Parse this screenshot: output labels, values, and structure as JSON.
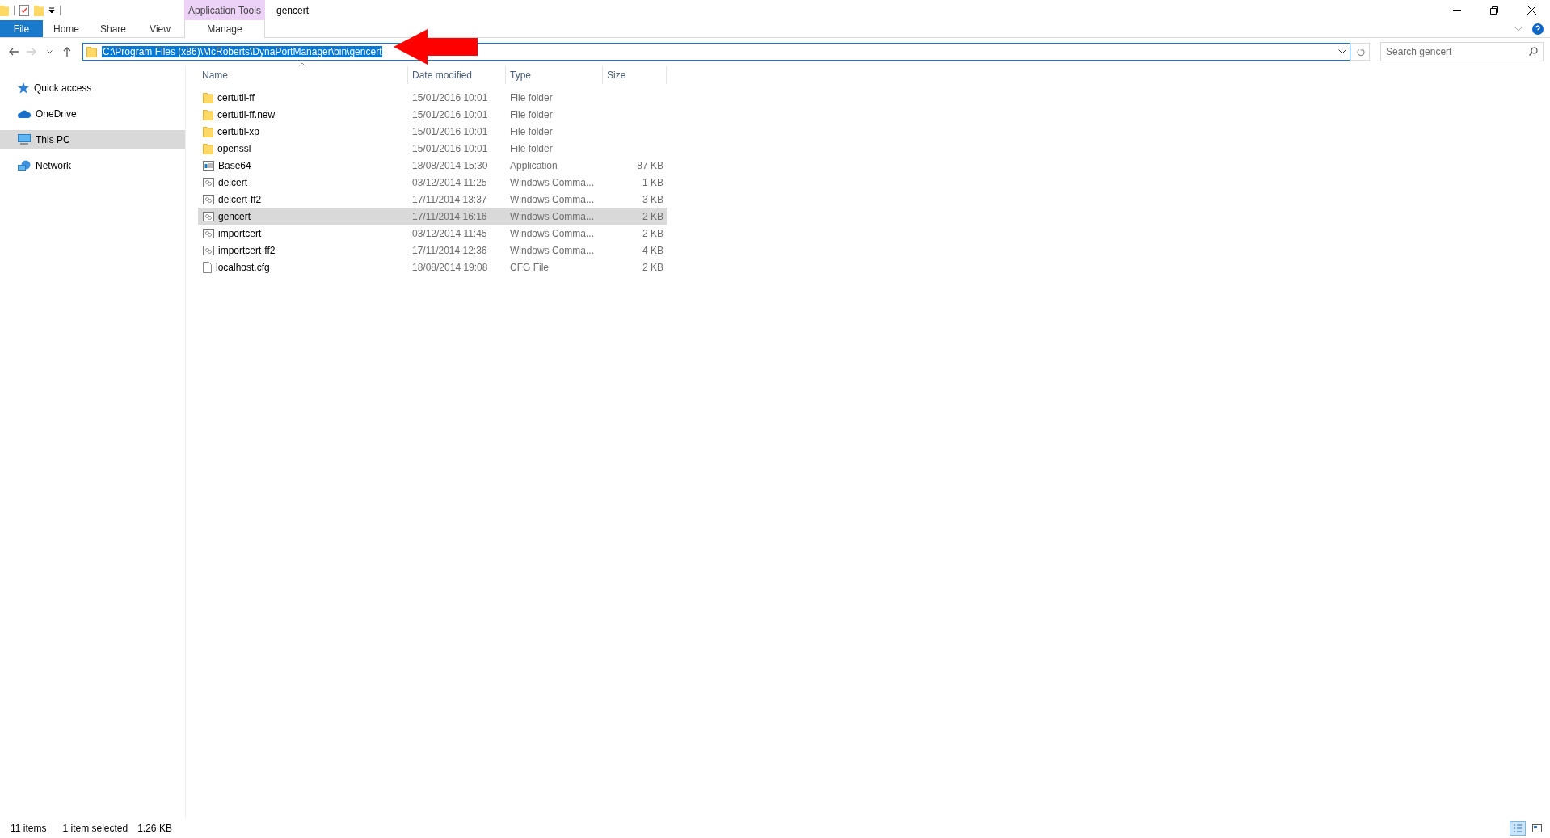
{
  "window": {
    "title": "gencert",
    "context_group": "Application Tools"
  },
  "ribbon_tabs": [
    {
      "label": "File",
      "kind": "file",
      "selected": false
    },
    {
      "label": "Home",
      "kind": "tab",
      "selected": false
    },
    {
      "label": "Share",
      "kind": "tab",
      "selected": false
    },
    {
      "label": "View",
      "kind": "tab",
      "selected": false
    },
    {
      "label": "Manage",
      "kind": "context",
      "selected": true
    }
  ],
  "address": {
    "value": "C:\\Program Files (x86)\\McRoberts\\DynaPortManager\\bin\\gencert"
  },
  "search": {
    "placeholder": "Search gencert"
  },
  "sidebar": {
    "items": [
      {
        "label": "Quick access",
        "kind": "star",
        "selected": false
      },
      {
        "label": "OneDrive",
        "kind": "cloud",
        "selected": false
      },
      {
        "label": "This PC",
        "kind": "pc",
        "selected": true
      },
      {
        "label": "Network",
        "kind": "network",
        "selected": false
      }
    ]
  },
  "table": {
    "columns": [
      "Name",
      "Date modified",
      "Type",
      "Size"
    ],
    "rows": [
      {
        "name": "certutil-ff",
        "date": "15/01/2016 10:01",
        "type": "File folder",
        "size": "",
        "kind": "folder",
        "selected": false
      },
      {
        "name": "certutil-ff.new",
        "date": "15/01/2016 10:01",
        "type": "File folder",
        "kind": "folder",
        "selected": false
      },
      {
        "name": "certutil-xp",
        "date": "15/01/2016 10:01",
        "type": "File folder",
        "kind": "folder",
        "selected": false
      },
      {
        "name": "openssl",
        "date": "15/01/2016 10:01",
        "type": "File folder",
        "kind": "folder",
        "selected": false
      },
      {
        "name": "Base64",
        "date": "18/08/2014 15:30",
        "type": "Application",
        "size": "87 KB",
        "kind": "app",
        "selected": false
      },
      {
        "name": "delcert",
        "date": "03/12/2014 11:25",
        "type": "Windows Comma...",
        "size": "1 KB",
        "kind": "cmd",
        "selected": false
      },
      {
        "name": "delcert-ff2",
        "date": "17/11/2014 13:37",
        "type": "Windows Comma...",
        "size": "3 KB",
        "kind": "cmd",
        "selected": false
      },
      {
        "name": "gencert",
        "date": "17/11/2014 16:16",
        "type": "Windows Comma...",
        "size": "2 KB",
        "kind": "cmd",
        "selected": true
      },
      {
        "name": "importcert",
        "date": "03/12/2014 11:45",
        "type": "Windows Comma...",
        "size": "2 KB",
        "kind": "cmd",
        "selected": false
      },
      {
        "name": "importcert-ff2",
        "date": "17/11/2014 12:36",
        "type": "Windows Comma...",
        "size": "4 KB",
        "kind": "cmd",
        "selected": false
      },
      {
        "name": "localhost.cfg",
        "date": "18/08/2014 19:08",
        "type": "CFG File",
        "size": "2 KB",
        "kind": "file",
        "selected": false
      }
    ]
  },
  "status_bar": {
    "count": "11 items",
    "selection": "1 item selected",
    "selection_size": "1.26 KB"
  }
}
